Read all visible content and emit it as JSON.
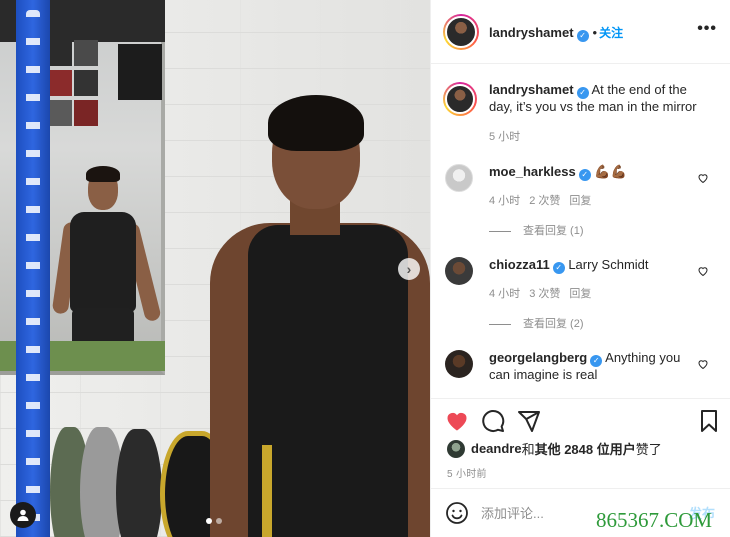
{
  "header": {
    "username": "landryshamet",
    "separator": "•",
    "follow_label": "关注",
    "more_label": "•••"
  },
  "caption": {
    "username": "landryshamet",
    "text": "At the end of the day, it’s you vs the man in the mirror",
    "time": "5 小时"
  },
  "comments": [
    {
      "username": "moe_harkless",
      "text": "💪🏾💪🏾",
      "time": "4 小时",
      "likes": "2 次赞",
      "reply_label": "回复",
      "view_replies": "查看回复 (1)"
    },
    {
      "username": "chiozza11",
      "text": "Larry Schmidt",
      "time": "4 小时",
      "likes": "3 次赞",
      "reply_label": "回复",
      "view_replies": "查看回复 (2)"
    },
    {
      "username": "georgelangberg",
      "text": "Anything you can imagine is real"
    }
  ],
  "likes": {
    "first_user": "deandre",
    "rest": " 和 ",
    "others_bold": "其他 2848 位用户",
    "suffix": " 赞了"
  },
  "timeago": "5 小时前",
  "add_comment": {
    "placeholder": "添加评论...",
    "post_label": "发布"
  },
  "watermark": "865367.COM",
  "colors": {
    "link_blue": "#0095f6",
    "verified_blue": "#3897f0",
    "heart_red": "#ed4956",
    "muted_gray": "#8e8e8e"
  },
  "icons": [
    "verified-icon",
    "heart-icon",
    "comment-icon",
    "share-icon",
    "bookmark-icon",
    "emoji-icon",
    "chevron-right-icon",
    "user-tag-icon"
  ],
  "carousel": {
    "slides": 2,
    "active_slide": 1
  }
}
